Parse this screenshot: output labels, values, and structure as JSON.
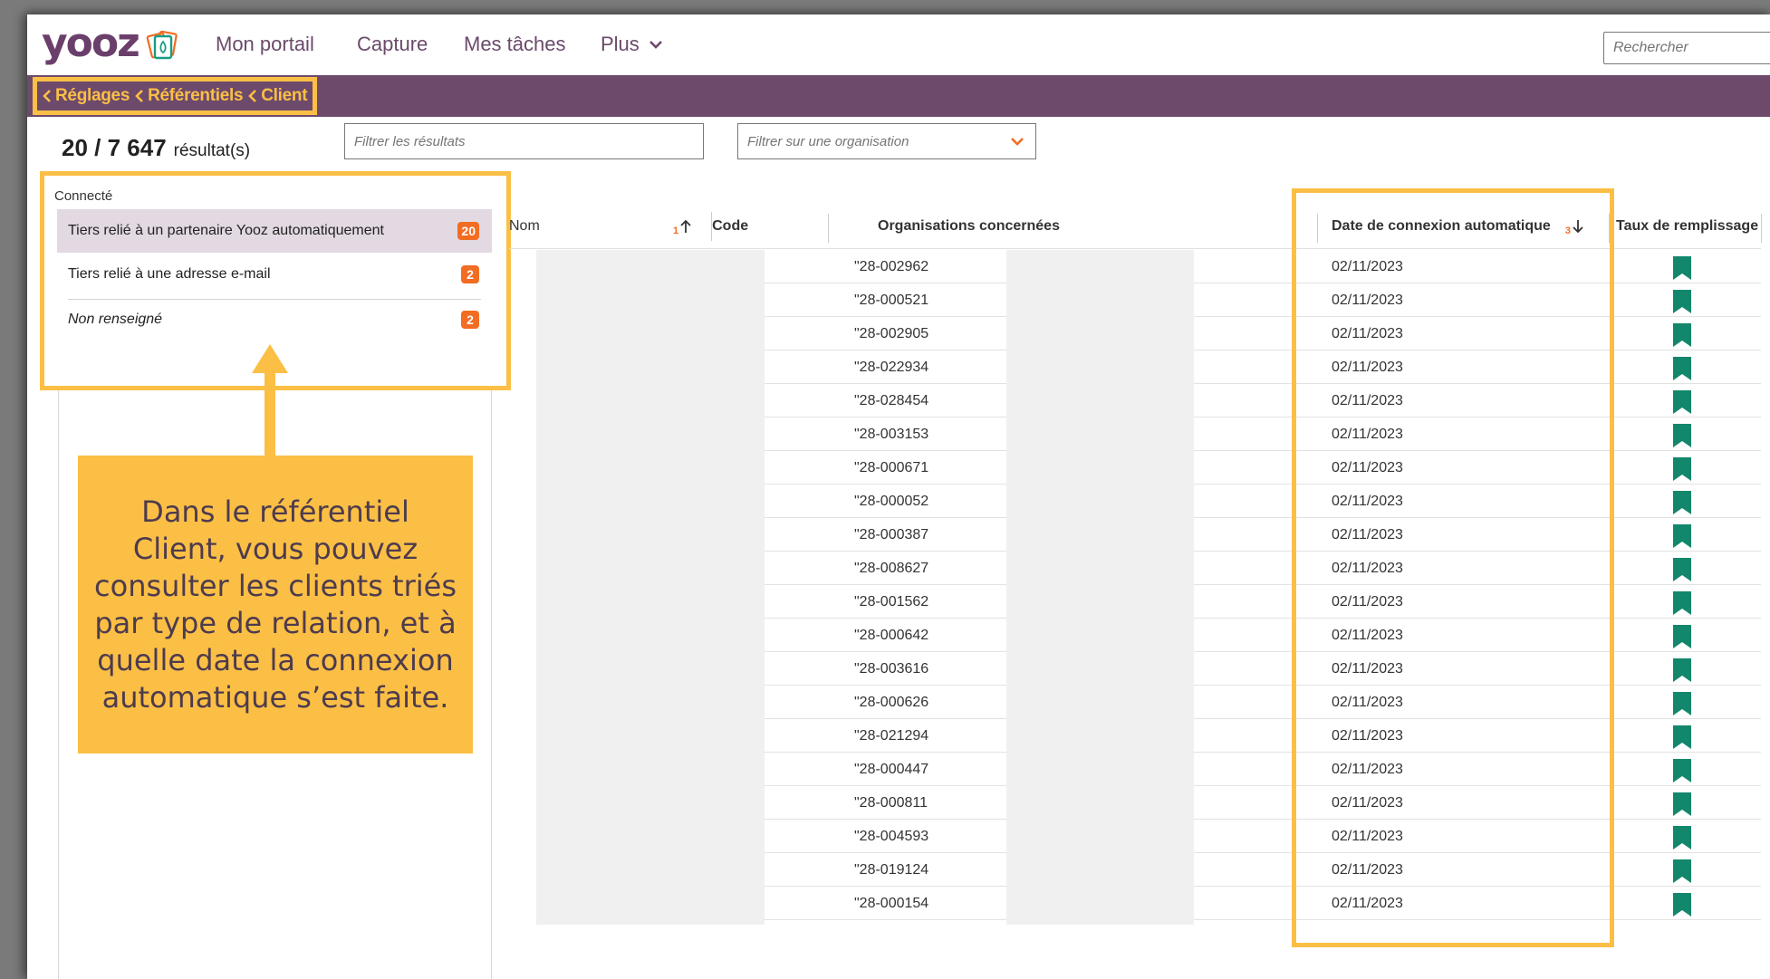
{
  "logo": {
    "text": "yooz"
  },
  "nav": {
    "items": [
      "Mon portail",
      "Capture",
      "Mes tâches"
    ],
    "more_label": "Plus",
    "search_placeholder": "Rechercher"
  },
  "breadcrumb": [
    "Réglages",
    "Référentiels",
    "Client"
  ],
  "results": {
    "count": "20 / 7 647",
    "label": "résultat(s)"
  },
  "filters": {
    "results_placeholder": "Filtrer les résultats",
    "org_placeholder": "Filtrer sur une organisation"
  },
  "facet": {
    "title": "Connecté",
    "items": [
      {
        "label": "Tiers relié à un partenaire Yooz automatiquement",
        "count": "20",
        "active": true
      },
      {
        "label": "Tiers relié à une adresse e-mail",
        "count": "2",
        "active": false
      },
      {
        "label": "Non renseigné",
        "count": "2",
        "active": false
      }
    ]
  },
  "callout": {
    "text": "Dans le référentiel Client, vous pouvez consulter les clients triés par type de relation, et à quelle date la connexion automatique s’est faite."
  },
  "table": {
    "columns": {
      "nom": "Nom",
      "code": "Code",
      "code_sort_order": "1",
      "orgs": "Organisations concernées",
      "date": "Date de connexion automatique",
      "date_sort_order": "3",
      "taux": "Taux de remplissage"
    },
    "rows": [
      {
        "code": "\"28-002962",
        "date": "02/11/2023"
      },
      {
        "code": "\"28-000521",
        "date": "02/11/2023"
      },
      {
        "code": "\"28-002905",
        "date": "02/11/2023"
      },
      {
        "code": "\"28-022934",
        "date": "02/11/2023"
      },
      {
        "code": "\"28-028454",
        "date": "02/11/2023"
      },
      {
        "code": "\"28-003153",
        "date": "02/11/2023"
      },
      {
        "code": "\"28-000671",
        "date": "02/11/2023"
      },
      {
        "code": "\"28-000052",
        "date": "02/11/2023"
      },
      {
        "code": "\"28-000387",
        "date": "02/11/2023"
      },
      {
        "code": "\"28-008627",
        "date": "02/11/2023"
      },
      {
        "code": "\"28-001562",
        "date": "02/11/2023"
      },
      {
        "code": "\"28-000642",
        "date": "02/11/2023"
      },
      {
        "code": "\"28-003616",
        "date": "02/11/2023"
      },
      {
        "code": "\"28-000626",
        "date": "02/11/2023"
      },
      {
        "code": "\"28-021294",
        "date": "02/11/2023"
      },
      {
        "code": "\"28-000447",
        "date": "02/11/2023"
      },
      {
        "code": "\"28-000811",
        "date": "02/11/2023"
      },
      {
        "code": "\"28-004593",
        "date": "02/11/2023"
      },
      {
        "code": "\"28-019124",
        "date": "02/11/2023"
      },
      {
        "code": "\"28-000154",
        "date": "02/11/2023"
      }
    ]
  },
  "colors": {
    "brand_purple": "#6d4a6c",
    "highlight_yellow": "#fbbf45",
    "badge_orange": "#f26c22",
    "flag_green": "#13876b"
  },
  "icons": [
    "chevron-left-icon",
    "chevron-down-icon",
    "sort-asc-icon",
    "sort-desc-icon",
    "bookmark-icon"
  ]
}
